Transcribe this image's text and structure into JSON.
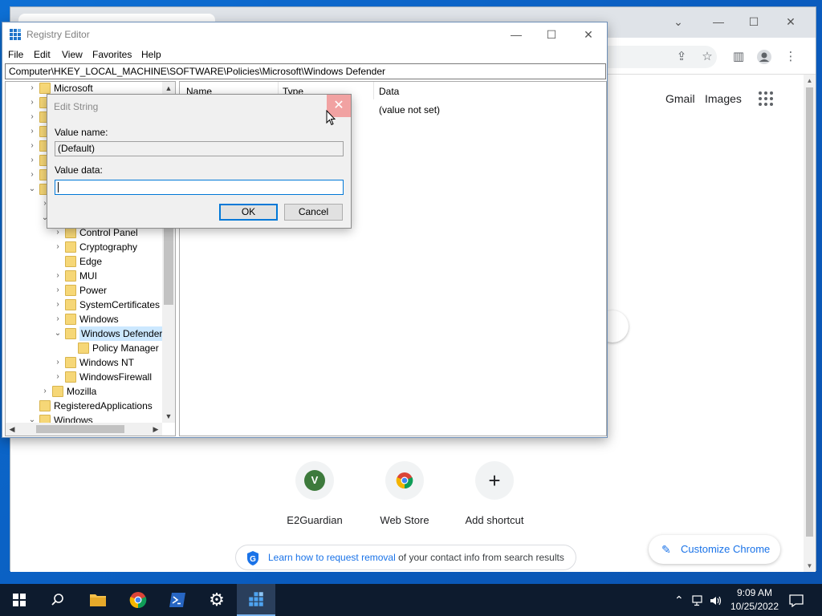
{
  "chrome": {
    "header_links": [
      "Gmail",
      "Images"
    ],
    "shortcuts": [
      {
        "label": "E2Guardian",
        "icon": "v-letter-icon",
        "letter": "V"
      },
      {
        "label": "Web Store",
        "icon": "chrome-webstore-icon"
      },
      {
        "label": "Add shortcut",
        "icon": "plus-icon",
        "symbol": "+"
      }
    ],
    "removal_link": "Learn how to request removal",
    "removal_text": " of your contact info from search results",
    "customize_label": "Customize Chrome"
  },
  "regedit": {
    "title": "Registry Editor",
    "menu": [
      "File",
      "Edit",
      "View",
      "Favorites",
      "Help"
    ],
    "address": "Computer\\HKEY_LOCAL_MACHINE\\SOFTWARE\\Policies\\Microsoft\\Windows Defender",
    "tree": [
      {
        "label": "Microsoft",
        "chevron": ">"
      },
      {
        "label": "",
        "chevron": ">"
      },
      {
        "label": "",
        "chevron": ">"
      },
      {
        "label": "",
        "chevron": ">"
      },
      {
        "label": "",
        "chevron": ">"
      },
      {
        "label": "",
        "chevron": ">"
      },
      {
        "label": "",
        "chevron": ">"
      },
      {
        "label": "",
        "chevron": "v"
      },
      {
        "label": "",
        "chevron": ">"
      },
      {
        "label": "",
        "chevron": "v"
      },
      {
        "label": "Control Panel",
        "chevron": ">"
      },
      {
        "label": "Cryptography",
        "chevron": ">"
      },
      {
        "label": "Edge",
        "chevron": ""
      },
      {
        "label": "MUI",
        "chevron": ">"
      },
      {
        "label": "Power",
        "chevron": ">"
      },
      {
        "label": "SystemCertificates",
        "chevron": ">"
      },
      {
        "label": "Windows",
        "chevron": ">"
      },
      {
        "label": "Windows Defender",
        "chevron": "v",
        "selected": true
      },
      {
        "label": "Policy Manager",
        "chevron": ""
      },
      {
        "label": "Windows NT",
        "chevron": ">"
      },
      {
        "label": "WindowsFirewall",
        "chevron": ">"
      },
      {
        "label": "Mozilla",
        "chevron": ">"
      },
      {
        "label": "RegisteredApplications",
        "chevron": ""
      },
      {
        "label": "Windows",
        "chevron": "v"
      }
    ],
    "columns": [
      "Name",
      "Type",
      "Data"
    ],
    "row": {
      "data": "(value not set)"
    }
  },
  "dialog": {
    "title": "Edit String",
    "value_name_label": "Value name:",
    "value_name": "(Default)",
    "value_data_label": "Value data:",
    "value_data": "",
    "ok_label": "OK",
    "cancel_label": "Cancel"
  },
  "taskbar": {
    "time": "9:09 AM",
    "date": "10/25/2022"
  }
}
